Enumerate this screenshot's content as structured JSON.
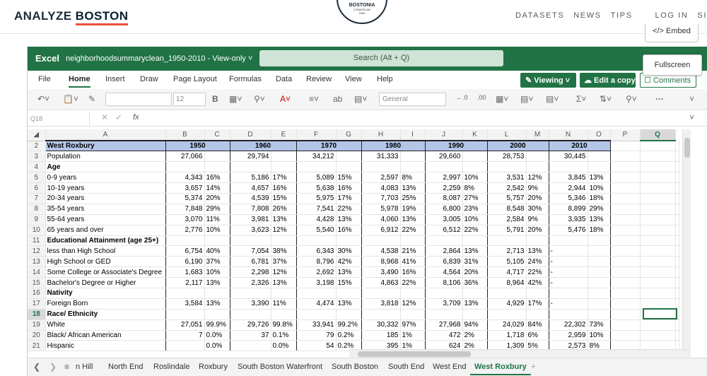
{
  "site": {
    "brand_part1": "ANALYZE ",
    "brand_part2": "BOSTON",
    "seal_line1": "BOSTONIA",
    "seal_line2": "CONDITA AD",
    "seal_line3": "1630",
    "nav": [
      "DATASETS",
      "NEWS",
      "TIPS",
      "LOG IN",
      "SI"
    ],
    "embed_label": "</> Embed"
  },
  "excel": {
    "app_name": "Excel",
    "doc_title": "neighborhoodsummaryclean_1950-2010  -  View-only ˅",
    "search_placeholder": "Search (Alt + Q)",
    "fullscreen_label": "Fullscreen",
    "ribbon_tabs": [
      "File",
      "Home",
      "Insert",
      "Draw",
      "Page Layout",
      "Formulas",
      "Data",
      "Review",
      "View",
      "Help"
    ],
    "viewing_label": "✎ Viewing ˅",
    "edit_copy_label": "☁ Edit a copy",
    "comments_label": "☐ Comments",
    "font_size": "12",
    "number_format": "General",
    "name_box": "Q18",
    "fx_label": "fx",
    "selected_column": "Q",
    "selected_row": "18"
  },
  "sheet": {
    "columns": [
      "A",
      "B",
      "C",
      "D",
      "E",
      "F",
      "G",
      "H",
      "I",
      "J",
      "K",
      "L",
      "M",
      "N",
      "O",
      "P",
      "Q"
    ],
    "rows": [
      {
        "n": "2",
        "a": "West Roxbury",
        "y1950": "1950",
        "y1960": "1960",
        "y1970": "1970",
        "y1980": "1980",
        "y1990": "1990",
        "y2000": "2000",
        "y2010": "2010",
        "type": "header"
      },
      {
        "n": "3",
        "a": "Population",
        "v": [
          "27,066",
          "",
          "29,794",
          "",
          "34,212",
          "",
          "31,333",
          "",
          "29,660",
          "",
          "28,753",
          "",
          "30,445",
          ""
        ]
      },
      {
        "n": "4",
        "a": "Age",
        "bold": true,
        "v": [
          "",
          "",
          "",
          "",
          "",
          "",
          "",
          "",
          "",
          "",
          "",
          "",
          "",
          ""
        ]
      },
      {
        "n": "5",
        "a": "0-9 years",
        "v": [
          "4,343",
          "16%",
          "5,186",
          "17%",
          "5,089",
          "15%",
          "2,597",
          "8%",
          "2,997",
          "10%",
          "3,531",
          "12%",
          "3,845",
          "13%"
        ]
      },
      {
        "n": "6",
        "a": "10-19 years",
        "v": [
          "3,657",
          "14%",
          "4,657",
          "16%",
          "5,638",
          "16%",
          "4,083",
          "13%",
          "2,259",
          "8%",
          "2,542",
          "9%",
          "2,944",
          "10%"
        ]
      },
      {
        "n": "7",
        "a": "20-34 years",
        "v": [
          "5,374",
          "20%",
          "4,539",
          "15%",
          "5,975",
          "17%",
          "7,703",
          "25%",
          "8,087",
          "27%",
          "5,757",
          "20%",
          "5,346",
          "18%"
        ]
      },
      {
        "n": "8",
        "a": "35-54 years",
        "v": [
          "7,848",
          "29%",
          "7,808",
          "26%",
          "7,541",
          "22%",
          "5,978",
          "19%",
          "6,800",
          "23%",
          "8,548",
          "30%",
          "8,899",
          "29%"
        ]
      },
      {
        "n": "9",
        "a": "55-64 years",
        "v": [
          "3,070",
          "11%",
          "3,981",
          "13%",
          "4,428",
          "13%",
          "4,060",
          "13%",
          "3,005",
          "10%",
          "2,584",
          "9%",
          "3,935",
          "13%"
        ]
      },
      {
        "n": "10",
        "a": "65 years and over",
        "v": [
          "2,776",
          "10%",
          "3,623",
          "12%",
          "5,540",
          "16%",
          "6,912",
          "22%",
          "6,512",
          "22%",
          "5,791",
          "20%",
          "5,476",
          "18%"
        ]
      },
      {
        "n": "11",
        "a": "Educational Attainment (age 25+)",
        "bold": true,
        "v": [
          "",
          "",
          "",
          "",
          "",
          "",
          "",
          "",
          "",
          "",
          "",
          "",
          "",
          ""
        ]
      },
      {
        "n": "12",
        "a": "less than High School",
        "v": [
          "6,754",
          "40%",
          "7,054",
          "38%",
          "6,343",
          "30%",
          "4,538",
          "21%",
          "2,864",
          "13%",
          "2,713",
          "13%",
          "-",
          ""
        ]
      },
      {
        "n": "13",
        "a": "High School or GED",
        "v": [
          "6,190",
          "37%",
          "6,781",
          "37%",
          "8,796",
          "42%",
          "8,968",
          "41%",
          "6,839",
          "31%",
          "5,105",
          "24%",
          "-",
          ""
        ]
      },
      {
        "n": "14",
        "a": "Some College or Associate's Degree",
        "v": [
          "1,683",
          "10%",
          "2,298",
          "12%",
          "2,692",
          "13%",
          "3,490",
          "16%",
          "4,564",
          "20%",
          "4,717",
          "22%",
          "-",
          ""
        ]
      },
      {
        "n": "15",
        "a": "Bachelor's Degree or Higher",
        "v": [
          "2,117",
          "13%",
          "2,326",
          "13%",
          "3,198",
          "15%",
          "4,863",
          "22%",
          "8,106",
          "36%",
          "8,964",
          "42%",
          "-",
          ""
        ]
      },
      {
        "n": "16",
        "a": "Nativity",
        "bold": true,
        "v": [
          "",
          "",
          "",
          "",
          "",
          "",
          "",
          "",
          "",
          "",
          "",
          "",
          "",
          ""
        ]
      },
      {
        "n": "17",
        "a": "Foreign Born",
        "v": [
          "3,584",
          "13%",
          "3,390",
          "11%",
          "4,474",
          "13%",
          "3,818",
          "12%",
          "3,709",
          "13%",
          "4,929",
          "17%",
          "-",
          ""
        ]
      },
      {
        "n": "18",
        "a": "Race/ Ethnicity",
        "bold": true,
        "v": [
          "",
          "",
          "",
          "",
          "",
          "",
          "",
          "",
          "",
          "",
          "",
          "",
          "",
          ""
        ]
      },
      {
        "n": "19",
        "a": "White",
        "v": [
          "27,051",
          "99.9%",
          "29,726",
          "99.8%",
          "33,941",
          "99.2%",
          "30,332",
          "97%",
          "27,968",
          "94%",
          "24,029",
          "84%",
          "22,302",
          "73%"
        ]
      },
      {
        "n": "20",
        "a": "Black/ African American",
        "v": [
          "7",
          "0.0%",
          "37",
          "0.1%",
          "79",
          "0.2%",
          "185",
          "1%",
          "472",
          "2%",
          "1,718",
          "6%",
          "2,959",
          "10%"
        ]
      },
      {
        "n": "21",
        "a": "Hispanic",
        "v": [
          "",
          "0.0%",
          "",
          "0.0%",
          "54",
          "0.2%",
          "395",
          "1%",
          "624",
          "2%",
          "1,309",
          "5%",
          "2,573",
          "8%"
        ]
      }
    ]
  },
  "sheet_tabs": [
    "n Hill",
    "North End",
    "Roslindale",
    "Roxbury",
    "South Boston Waterfront",
    "South Boston",
    "South End",
    "West End",
    "West Roxbury",
    "+"
  ],
  "active_sheet": "West Roxbury",
  "colors": {
    "excel_green": "#217346",
    "header_blue": "#b4c6e7",
    "boston_red": "#ea4f3c"
  }
}
